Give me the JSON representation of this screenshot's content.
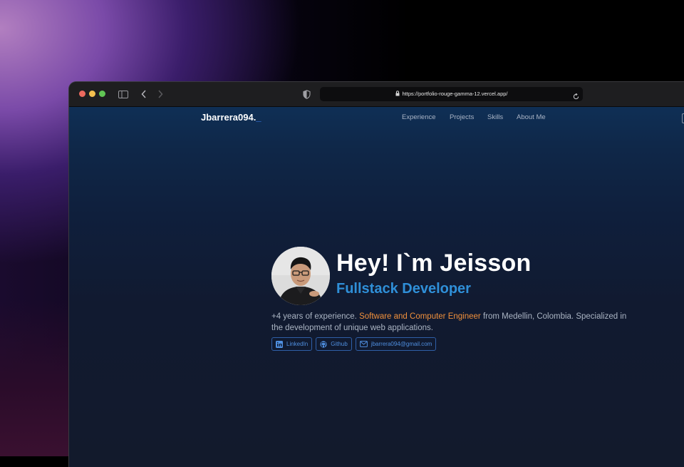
{
  "browser": {
    "url": "https://portfolio-rouge-gamma-12.vercel.app/"
  },
  "nav": {
    "logo": "Jbarrera094.",
    "logo_cursor": "_",
    "links": [
      {
        "label": "Experience"
      },
      {
        "label": "Projects"
      },
      {
        "label": "Skills"
      },
      {
        "label": "About Me"
      }
    ]
  },
  "hero": {
    "title": "Hey! I`m Jeisson",
    "subtitle": "Fullstack Developer",
    "desc_before": "+4 years of experience. ",
    "desc_highlight": "Software and Computer Engineer",
    "desc_after": " from Medellin, Colombia. Specialized in the development of unique web applications.",
    "socials": [
      {
        "label": "LinkedIn",
        "icon": "linkedin-icon"
      },
      {
        "label": "Github",
        "icon": "github-icon"
      },
      {
        "label": "jbarrera094@gmail.com",
        "icon": "mail-icon"
      }
    ]
  },
  "colors": {
    "accent_blue": "#2f8fd8",
    "highlight_orange": "#f0903c",
    "link_blue": "#4f8fe0"
  }
}
